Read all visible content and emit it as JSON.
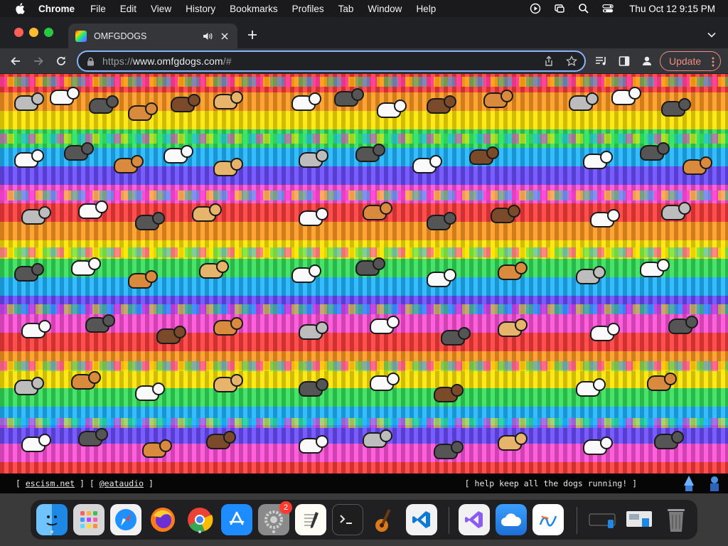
{
  "menubar": {
    "app_name": "Chrome",
    "items": [
      "File",
      "Edit",
      "View",
      "History",
      "Bookmarks",
      "Profiles",
      "Tab",
      "Window",
      "Help"
    ],
    "clock": "Thu Oct 12  9:15 PM"
  },
  "tab": {
    "title": "OMFGDOGS"
  },
  "omnibox": {
    "url_scheme": "https://",
    "url_host": "www.omfgdogs.com",
    "url_rest": "/#"
  },
  "toolbar": {
    "update_label": "Update"
  },
  "footer": {
    "bracket_open_1": "[ ",
    "link_1": "escism.net",
    "bracket_mid": " ] [ ",
    "link_2": "@eataudio",
    "bracket_close": " ]",
    "message": "[ help keep all the dogs running! ]"
  },
  "dock": {
    "settings_badge": "2",
    "items": [
      "finder",
      "launchpad",
      "safari",
      "firefox",
      "chrome",
      "app-store",
      "system-settings",
      "textedit",
      "terminal",
      "guitar-app",
      "vscode",
      "visual-studio",
      "weather",
      "freeform"
    ]
  },
  "colors": {
    "accent": "#8ab4f8",
    "update": "#f28b82"
  }
}
